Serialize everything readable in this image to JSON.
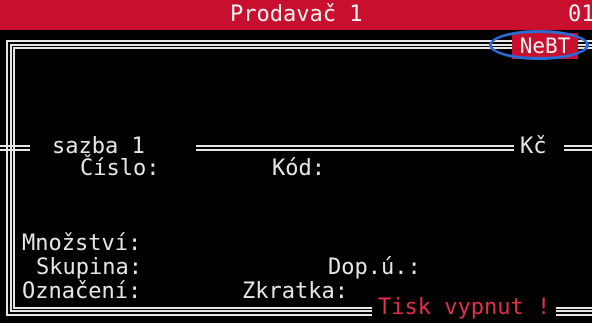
{
  "header": {
    "title": "Prodavač 1",
    "number": "01"
  },
  "badge": {
    "label": "NeBT",
    "color": "#c8102e",
    "highlight_color": "#2b6cd6"
  },
  "section": {
    "rate_label": "sazba 1",
    "currency": "Kč"
  },
  "fields": {
    "cislo": "Číslo:",
    "kod": "Kód:",
    "mnozstvi": "Množství:",
    "skupina": "Skupina:",
    "dop_u": "Dop.ú.:",
    "oznaceni": "Označení:",
    "zkratka": "Zkratka:"
  },
  "status": {
    "message": "Tisk vypnut !",
    "color": "#e0304a"
  },
  "colors": {
    "header_bg": "#c8102e",
    "background": "#000000",
    "text": "#e6e6e6"
  }
}
